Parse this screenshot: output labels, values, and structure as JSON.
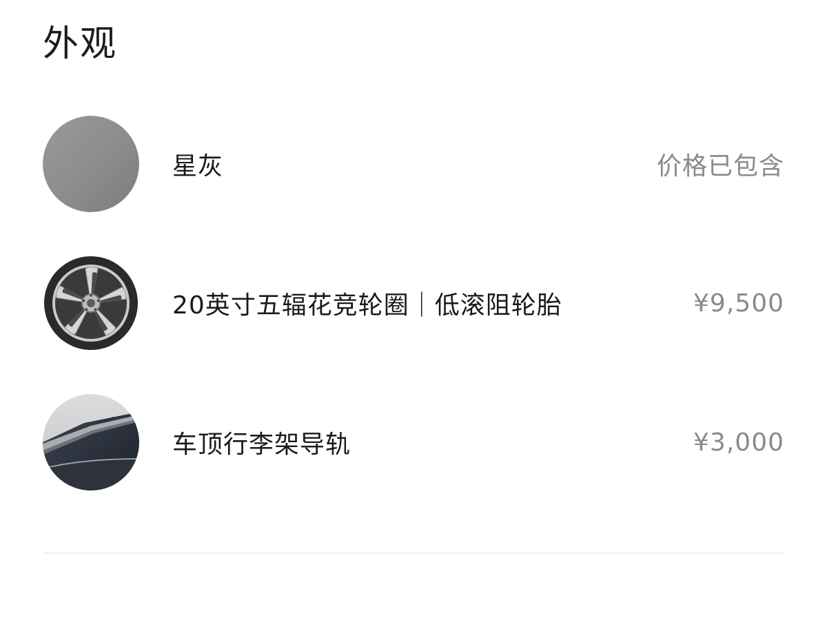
{
  "section": {
    "title": "外观"
  },
  "options": [
    {
      "label": "星灰",
      "price": "价格已包含",
      "thumbnail": "paint-swatch-icon",
      "swatch_color": "#8e8e90"
    },
    {
      "label": "20英寸五辐花竞轮圈｜低滚阻轮胎",
      "price": "¥9,500",
      "thumbnail": "wheel-icon"
    },
    {
      "label": "车顶行李架导轨",
      "price": "¥3,000",
      "thumbnail": "roof-rail-icon"
    }
  ],
  "colors": {
    "text_primary": "#1a1a1a",
    "text_secondary": "#8a8a8a",
    "divider": "#ededed"
  }
}
